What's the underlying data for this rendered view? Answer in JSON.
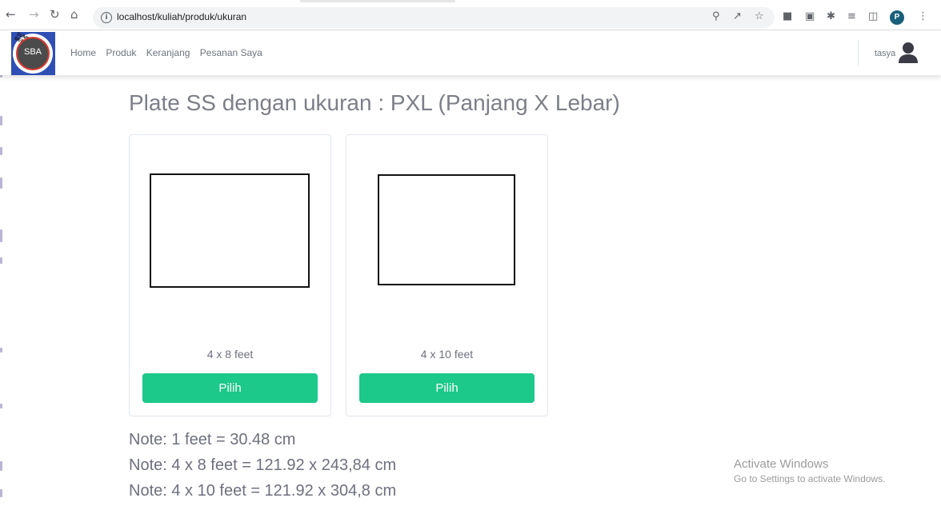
{
  "browser": {
    "url": "localhost/kuliah/produk/ukuran",
    "profile_initial": "P",
    "icons": [
      "back-icon",
      "forward-icon",
      "reload-icon",
      "home-icon",
      "info-icon",
      "zoom-icon",
      "share-icon",
      "star-icon",
      "extension-icon",
      "reading-list-icon",
      "side-panel-icon",
      "menu-icon"
    ]
  },
  "navbar": {
    "logo_text": "SBA",
    "logo_arc_text": "SUMBER BERKAT ABADI",
    "links": [
      "Home",
      "Produk",
      "Keranjang",
      "Pesanan Saya"
    ],
    "username": "tasya"
  },
  "main": {
    "title": "Plate SS dengan ukuran : PXL (Panjang X Lebar)",
    "cards": [
      {
        "label": "4 x 8 feet",
        "button": "Pilih"
      },
      {
        "label": "4 x 10 feet",
        "button": "Pilih"
      }
    ],
    "notes": [
      "Note: 1 feet = 30.48 cm",
      "Note: 4 x 8 feet = 121.92 x 243,84 cm",
      "Note: 4 x 10 feet = 121.92 x 304,8 cm"
    ]
  },
  "watermark": {
    "title": "Activate Windows",
    "subtitle": "Go to Settings to activate Windows."
  },
  "colors": {
    "accent": "#1cc88a",
    "logo_bg": "#2f4fb5"
  }
}
